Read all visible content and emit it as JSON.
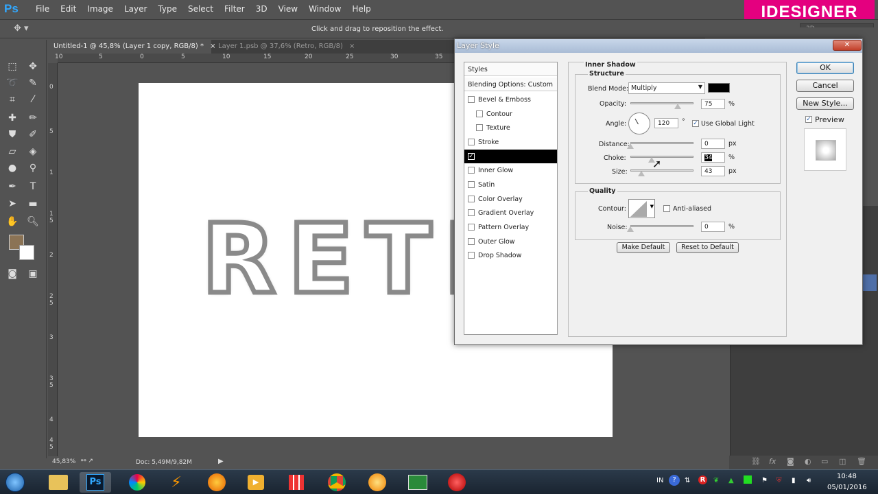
{
  "app": {
    "logo": "Ps",
    "menu": [
      "File",
      "Edit",
      "Image",
      "Layer",
      "Type",
      "Select",
      "Filter",
      "3D",
      "View",
      "Window",
      "Help"
    ],
    "brand": "IDESIGNER"
  },
  "options_bar": {
    "hint": "Click and drag to reposition the effect.",
    "workspace": "3D"
  },
  "tabs": [
    {
      "label": "Untitled-1 @ 45,8% (Layer 1 copy, RGB/8) *",
      "close": "×"
    },
    {
      "label": "Layer 1.psb @ 37,6% (Retro, RGB/8)",
      "close": "×"
    }
  ],
  "ruler_top": [
    "10",
    "5",
    "0",
    "5",
    "10",
    "15",
    "20",
    "25",
    "30",
    "35"
  ],
  "ruler_left": [
    "0",
    "5",
    "1",
    "1 5",
    "2",
    "2 5",
    "3",
    "3 5",
    "4",
    "4 5"
  ],
  "canvas": {
    "text": "RETRO",
    "fg_color": "#8b7355",
    "bg_color": "#ffffff"
  },
  "status": {
    "zoom": "45,83%",
    "doc": "Doc: 5,49M/9,82M"
  },
  "dialog": {
    "title": "Layer Style",
    "styles_header": "Styles",
    "blending": "Blending Options: Custom",
    "styles": [
      {
        "label": "Bevel & Emboss",
        "checked": false,
        "sub": false
      },
      {
        "label": "Contour",
        "checked": false,
        "sub": true
      },
      {
        "label": "Texture",
        "checked": false,
        "sub": true
      },
      {
        "label": "Stroke",
        "checked": false,
        "sub": false
      },
      {
        "label": "",
        "checked": true,
        "sub": false,
        "selected": true
      },
      {
        "label": "Inner Glow",
        "checked": false,
        "sub": false
      },
      {
        "label": "Satin",
        "checked": false,
        "sub": false
      },
      {
        "label": "Color Overlay",
        "checked": false,
        "sub": false
      },
      {
        "label": "Gradient Overlay",
        "checked": false,
        "sub": false
      },
      {
        "label": "Pattern Overlay",
        "checked": false,
        "sub": false
      },
      {
        "label": "Outer Glow",
        "checked": false,
        "sub": false
      },
      {
        "label": "Drop Shadow",
        "checked": false,
        "sub": false
      }
    ],
    "section_title": "Inner Shadow",
    "structure_title": "Structure",
    "blend_mode_label": "Blend Mode:",
    "blend_mode_value": "Multiply",
    "shadow_color": "#000000",
    "opacity_label": "Opacity:",
    "opacity_value": "75",
    "opacity_level": 0.75,
    "angle_label": "Angle:",
    "angle_value": "120",
    "angle_unit": "°",
    "use_global_light": "Use Global Light",
    "distance_label": "Distance:",
    "distance_value": "0",
    "distance_level": 0,
    "choke_label": "Choke:",
    "choke_value": "34",
    "choke_level": 0.34,
    "size_label": "Size:",
    "size_value": "43",
    "size_level": 0.17,
    "unit_pct": "%",
    "unit_px": "px",
    "quality_title": "Quality",
    "contour_label": "Contour:",
    "anti_aliased": "Anti-aliased",
    "noise_label": "Noise:",
    "noise_value": "0",
    "noise_level": 0,
    "make_default": "Make Default",
    "reset_default": "Reset to Default",
    "ok": "OK",
    "cancel": "Cancel",
    "new_style": "New Style...",
    "preview": "Preview"
  },
  "taskbar": {
    "lang": "IN",
    "time": "10:48",
    "date": "05/01/2016"
  }
}
